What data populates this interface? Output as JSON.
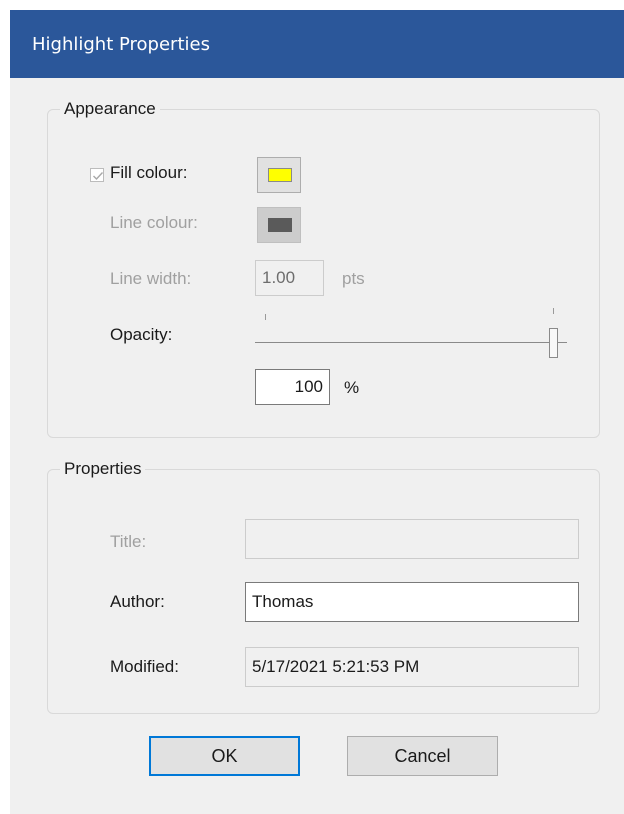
{
  "dialog": {
    "title": "Highlight Properties"
  },
  "appearance": {
    "legend": "Appearance",
    "fill_colour_label": "Fill colour:",
    "fill_colour_checked": true,
    "fill_colour": "#ffff00",
    "line_colour_label": "Line colour:",
    "line_colour": "#5a5a5a",
    "line_width_label": "Line width:",
    "line_width_value": "1.00",
    "line_width_unit": "pts",
    "opacity_label": "Opacity:",
    "opacity_level": 1.0,
    "opacity_value": "100",
    "opacity_unit": "%"
  },
  "properties": {
    "legend": "Properties",
    "title_label": "Title:",
    "title_value": "",
    "author_label": "Author:",
    "author_value": "Thomas",
    "modified_label": "Modified:",
    "modified_value": "5/17/2021 5:21:53 PM"
  },
  "buttons": {
    "ok_label": "OK",
    "cancel_label": "Cancel"
  },
  "colors": {
    "titlebar": "#2b579a",
    "accent": "#0078d7"
  }
}
